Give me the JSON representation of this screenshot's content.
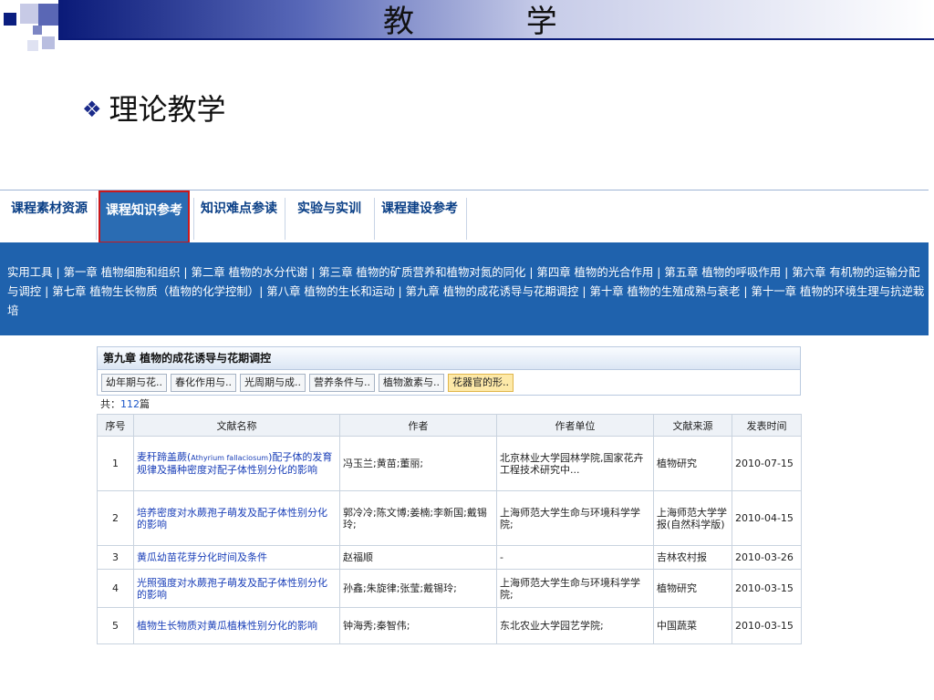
{
  "slide": {
    "title": "教 学",
    "bullet": "理论教学"
  },
  "site_nav": {
    "tabs": [
      {
        "label": "课程素材资源"
      },
      {
        "label": "课程知识参考",
        "active": true
      },
      {
        "label": "知识难点参读"
      },
      {
        "label": "实验与实训"
      },
      {
        "label": "课程建设参考"
      }
    ],
    "sub_links_text": "实用工具 | 第一章 植物细胞和组织 | 第二章 植物的水分代谢 | 第三章 植物的矿质营养和植物对氮的同化 | 第四章 植物的光合作用 | 第五章 植物的呼吸作用 | 第六章 有机物的运输分配与调控 | 第七章 植物生长物质（植物的化学控制）| 第八章 植物的生长和运动 | 第九章 植物的成花诱导与花期调控 | 第十章 植物的生殖成熟与衰老 | 第十一章 植物的环境生理与抗逆栽培",
    "colors": {
      "nav_blue": "#1f62ad",
      "active_border": "#c9181c"
    }
  },
  "panel": {
    "heading": "第九章 植物的成花诱导与花期调控",
    "sub_tabs": [
      {
        "label": "幼年期与花.."
      },
      {
        "label": "春化作用与.."
      },
      {
        "label": "光周期与成.."
      },
      {
        "label": "营养条件与.."
      },
      {
        "label": "植物激素与.."
      },
      {
        "label": "花器官的形..",
        "selected": true
      }
    ],
    "count_label": "共：",
    "count_value": "112",
    "count_unit": "篇",
    "columns": [
      "序号",
      "文献名称",
      "作者",
      "作者单位",
      "文献来源",
      "发表时间"
    ],
    "rows": [
      {
        "no": "1",
        "title_a": "麦秆蹄盖蕨(",
        "title_latin": "Athyrium fallaciosum",
        "title_b": ")配子体的发育规律及播种密度对配子体性别分化的影响",
        "authors": "冯玉兰;黄苗;董丽;",
        "org": "北京林业大学园林学院,国家花卉工程技术研究中...",
        "source": "植物研究",
        "date": "2010-07-15"
      },
      {
        "no": "2",
        "title": "培养密度对水蕨孢子萌发及配子体性别分化的影响",
        "authors": "郭冷冷;陈文博;姜楠;李新国;戴锡玲;",
        "org": "上海师范大学生命与环境科学学院;",
        "source": "上海师范大学学报(自然科学版)",
        "date": "2010-04-15"
      },
      {
        "no": "3",
        "title": "黄瓜幼苗花芽分化时间及条件",
        "authors": "赵福顺",
        "org": "-",
        "source": "吉林农村报",
        "date": "2010-03-26"
      },
      {
        "no": "4",
        "title": "光照强度对水蕨孢子萌发及配子体性别分化的影响",
        "authors": "孙鑫;朱旋律;张莹;戴锡玲;",
        "org": "上海师范大学生命与环境科学学院;",
        "source": "植物研究",
        "date": "2010-03-15"
      },
      {
        "no": "5",
        "title": "植物生长物质对黄瓜植株性别分化的影响",
        "authors": "钟海秀;秦智伟;",
        "org": "东北农业大学园艺学院;",
        "source": "中国蔬菜",
        "date": "2010-03-15"
      }
    ]
  }
}
